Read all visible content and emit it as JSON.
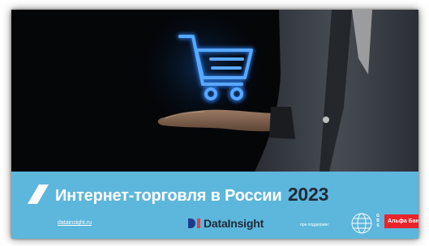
{
  "cover": {
    "title": "Интернет-торговля в России",
    "year": "2023",
    "site": "datainsight.ru",
    "brand": "DataInsight",
    "support_label": "при поддержке:",
    "partner_gbs_letters": [
      "G",
      "B",
      "S"
    ],
    "partner_bank": "Альфа Банк"
  },
  "colors": {
    "banner": "#5db6dc",
    "cart_glow": "#2f86ff",
    "brand_dark": "#1f2a38",
    "bank_red": "#e8242a"
  },
  "icons": [
    "shopping-cart-icon",
    "slash-icon",
    "globe-icon"
  ]
}
